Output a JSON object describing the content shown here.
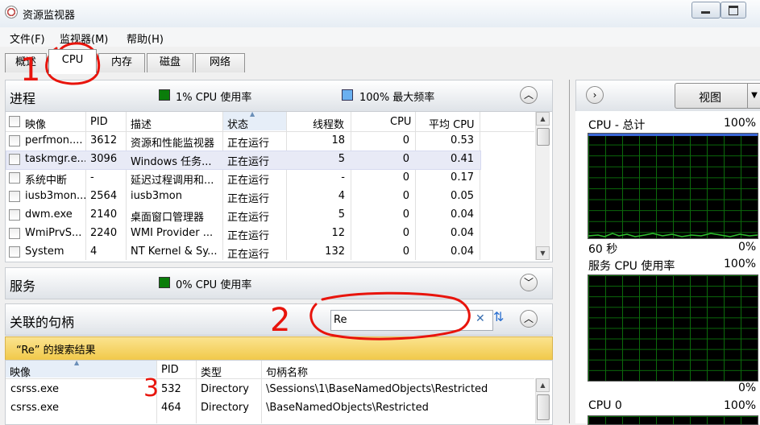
{
  "window": {
    "title": "资源监视器"
  },
  "menu": [
    "文件(F)",
    "监视器(M)",
    "帮助(H)"
  ],
  "tabs": [
    "概述",
    "CPU",
    "内存",
    "磁盘",
    "网络"
  ],
  "processes": {
    "title": "进程",
    "cpu_usage": "1% CPU 使用率",
    "max_freq": "100% 最大频率",
    "columns": [
      "映像",
      "PID",
      "描述",
      "状态",
      "线程数",
      "CPU",
      "平均 CPU"
    ],
    "rows": [
      [
        "perfmon....",
        "3612",
        "资源和性能监视器",
        "正在运行",
        "18",
        "0",
        "0.53"
      ],
      [
        "taskmgr.e...",
        "3096",
        "Windows 任务...",
        "正在运行",
        "5",
        "0",
        "0.41"
      ],
      [
        "系统中断",
        "-",
        "延迟过程调用和...",
        "正在运行",
        "-",
        "0",
        "0.17"
      ],
      [
        "iusb3mon....",
        "2564",
        "iusb3mon",
        "正在运行",
        "4",
        "0",
        "0.05"
      ],
      [
        "dwm.exe",
        "2140",
        "桌面窗口管理器",
        "正在运行",
        "5",
        "0",
        "0.04"
      ],
      [
        "WmiPrvS...",
        "2240",
        "WMI Provider ...",
        "正在运行",
        "12",
        "0",
        "0.04"
      ],
      [
        "System",
        "4",
        "NT Kernel & Sy...",
        "正在运行",
        "132",
        "0",
        "0.04"
      ]
    ]
  },
  "services": {
    "title": "服务",
    "cpu_usage": "0% CPU 使用率"
  },
  "handles": {
    "title": "关联的句柄",
    "search_value": "Re",
    "result_banner": "“Re” 的搜索结果",
    "columns": [
      "映像",
      "PID",
      "类型",
      "句柄名称"
    ],
    "rows": [
      [
        "csrss.exe",
        "532",
        "Directory",
        "\\Sessions\\1\\BaseNamedObjects\\Restricted"
      ],
      [
        "csrss.exe",
        "464",
        "Directory",
        "\\BaseNamedObjects\\Restricted"
      ]
    ]
  },
  "right_panel": {
    "view_label": "视图",
    "graphs": [
      {
        "title": "CPU - 总计",
        "value": "100%",
        "footer_left": "60 秒",
        "footer_right": "0%"
      },
      {
        "title": "服务 CPU 使用率",
        "value": "100%",
        "footer_right": "0%"
      },
      {
        "title": "CPU 0",
        "value": "100%"
      }
    ]
  },
  "annotations": [
    "1",
    "2",
    "3"
  ],
  "colors": {
    "banner": "#f7d66a",
    "graph_grid": "#0b6b0b",
    "graph_line": "#2ec02e",
    "annotation": "#e8140c",
    "selected_row": "#e8eaf6"
  }
}
